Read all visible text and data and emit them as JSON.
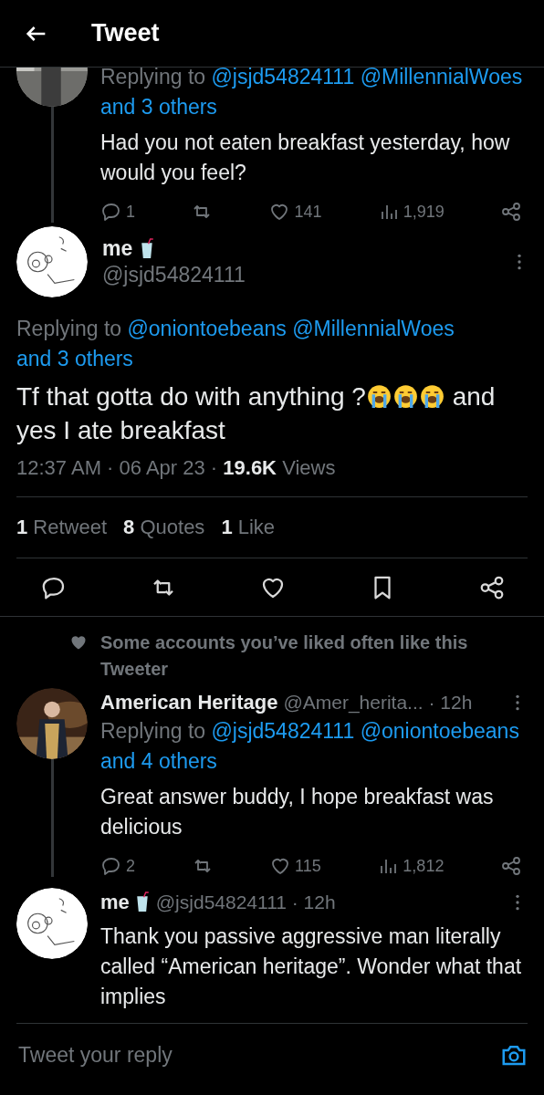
{
  "header": {
    "title": "Tweet"
  },
  "parent_tweet": {
    "avatar": {
      "kind": "picture"
    },
    "replying_prefix": "Replying to",
    "mentions": [
      "@jsjd54824111",
      "@MillennialWoes"
    ],
    "others": "and 3 others",
    "text": "Had you not eaten breakfast yesterday, how would you feel?",
    "actions": [
      {
        "kind": "reply",
        "count": "1"
      },
      {
        "kind": "retweet"
      },
      {
        "kind": "like",
        "count": "141"
      },
      {
        "kind": "views",
        "count": "1,919"
      },
      {
        "kind": "share"
      }
    ]
  },
  "main_tweet": {
    "name": "me",
    "badge": {
      "kind": "cup"
    },
    "handle": "@jsjd54824111",
    "replying_prefix": "Replying to",
    "mentions": [
      "@oniontoebeans",
      "@MillennialWoes"
    ],
    "others": "and 3 others",
    "text": [
      {
        "kind": "text",
        "text": "Tf that gotta do with anything ?"
      },
      {
        "kind": "emoji"
      },
      {
        "kind": "emoji"
      },
      {
        "kind": "emoji"
      },
      {
        "kind": "text",
        "text": " and yes I ate breakfast"
      }
    ],
    "meta": [
      {
        "text": "12:37 AM",
        "bold": false
      },
      {
        "text": "·",
        "bold": false
      },
      {
        "text": "06 Apr 23",
        "bold": false
      },
      {
        "text": "·",
        "bold": false
      },
      {
        "text": "19.6K",
        "bold": true
      },
      {
        "text": "Views",
        "bold": false
      }
    ],
    "engagement": [
      {
        "count": "1",
        "label": "Retweet"
      },
      {
        "count": "8",
        "label": "Quotes"
      },
      {
        "count": "1",
        "label": "Like"
      }
    ],
    "actions": [
      {
        "kind": "reply"
      },
      {
        "kind": "retweet"
      },
      {
        "kind": "like"
      },
      {
        "kind": "bookmark"
      },
      {
        "kind": "share"
      }
    ]
  },
  "social_context": "Some accounts you’ve liked often like this Tweeter",
  "replies": [
    {
      "avatar": {
        "kind": "picture"
      },
      "name": "American Heritage",
      "handle": "@Amer_herita...",
      "separator": "·",
      "time": "12h",
      "replying_prefix": "Replying to",
      "mentions": [
        "@jsjd54824111",
        "@oniontoebeans"
      ],
      "others": "and 4 others",
      "text": "Great answer buddy, I hope breakfast was delicious",
      "actions": [
        {
          "kind": "reply",
          "count": "2"
        },
        {
          "kind": "retweet"
        },
        {
          "kind": "like",
          "count": "115"
        },
        {
          "kind": "views",
          "count": "1,812"
        },
        {
          "kind": "share"
        }
      ]
    },
    {
      "avatar": {
        "kind": "sketch"
      },
      "name": "me",
      "badge": {
        "kind": "cup"
      },
      "handle": "@jsjd54824111",
      "separator": "·",
      "time": "12h",
      "text": "Thank you passive aggressive man literally called “American heritage”. Wonder what that implies"
    }
  ],
  "reply_bar": {
    "placeholder": "Tweet your reply"
  }
}
